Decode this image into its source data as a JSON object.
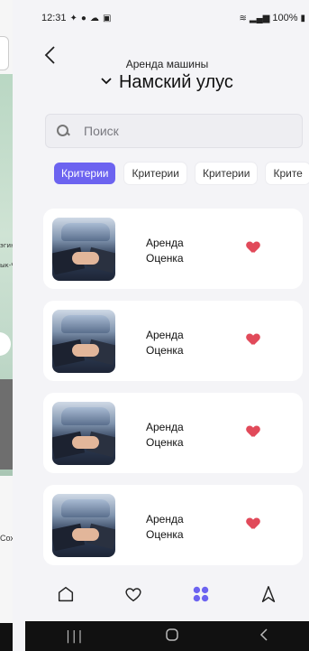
{
  "peek": {
    "map_labels": [
      "эгин",
      "ык-Ч"
    ],
    "bottom_label": "Сох"
  },
  "status": {
    "time": "12:31",
    "battery": "100%"
  },
  "header": {
    "subtitle": "Аренда машины",
    "title": "Намский улус"
  },
  "search": {
    "placeholder": "Поиск"
  },
  "chips": [
    "Критерии",
    "Критерии",
    "Критерии",
    "Крите"
  ],
  "colors": {
    "accent": "#6c63f0",
    "heart": "#e14a5a",
    "background": "#f4f4f7"
  },
  "cards": [
    {
      "line1": "Аренда",
      "line2": "Оценка"
    },
    {
      "line1": "Аренда",
      "line2": "Оценка"
    },
    {
      "line1": "Аренда",
      "line2": "Оценка"
    },
    {
      "line1": "Аренда",
      "line2": "Оценка"
    }
  ],
  "nav": [
    "home-icon",
    "heart-icon",
    "grid-icon",
    "navigation-icon"
  ]
}
